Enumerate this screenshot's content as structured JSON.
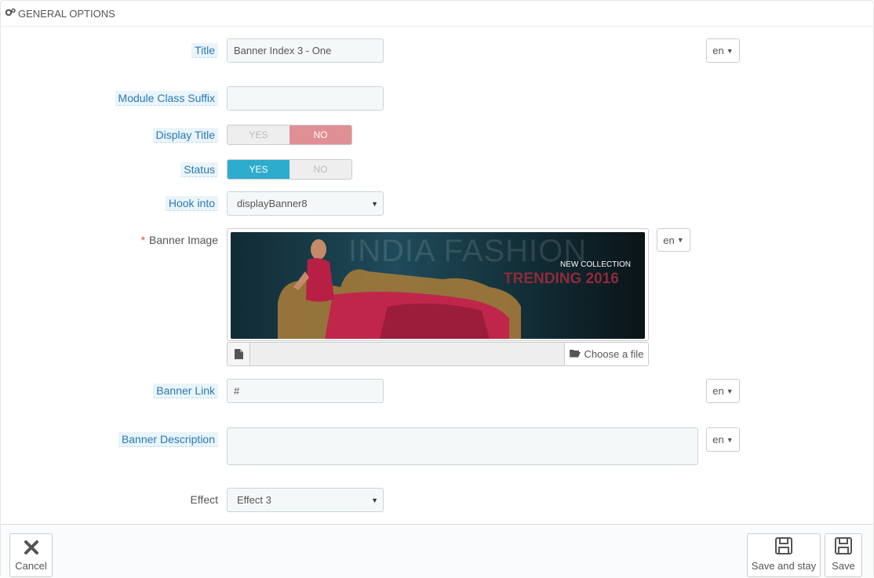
{
  "panel": {
    "title": "GENERAL OPTIONS",
    "icon": "gears-icon"
  },
  "fields": {
    "title": {
      "label": "Title",
      "value": "Banner Index 3 - One",
      "lang": "en"
    },
    "suffix": {
      "label": "Module Class Suffix",
      "value": ""
    },
    "display_title": {
      "label": "Display Title",
      "yes": "YES",
      "no": "NO",
      "selected": "NO"
    },
    "status": {
      "label": "Status",
      "yes": "YES",
      "no": "NO",
      "selected": "YES"
    },
    "hook": {
      "label": "Hook into",
      "value": "displayBanner8"
    },
    "banner_image": {
      "label": "Banner Image",
      "required_mark": "*",
      "lang": "en",
      "overlay_big": "INDIA FASHION",
      "overlay_small": "NEW COLLECTION",
      "overlay_trend": "TRENDING 2016",
      "choose_label": "Choose a file"
    },
    "banner_link": {
      "label": "Banner Link",
      "value": "#",
      "lang": "en"
    },
    "banner_description": {
      "label": "Banner Description",
      "value": "",
      "lang": "en"
    },
    "effect": {
      "label": "Effect",
      "value": "Effect 3"
    }
  },
  "footer": {
    "cancel": "Cancel",
    "save_stay": "Save and stay",
    "save": "Save"
  },
  "colors": {
    "yes_active": "#2eacce",
    "no_active": "#e08f95",
    "label_link": "#2a7ab0"
  }
}
